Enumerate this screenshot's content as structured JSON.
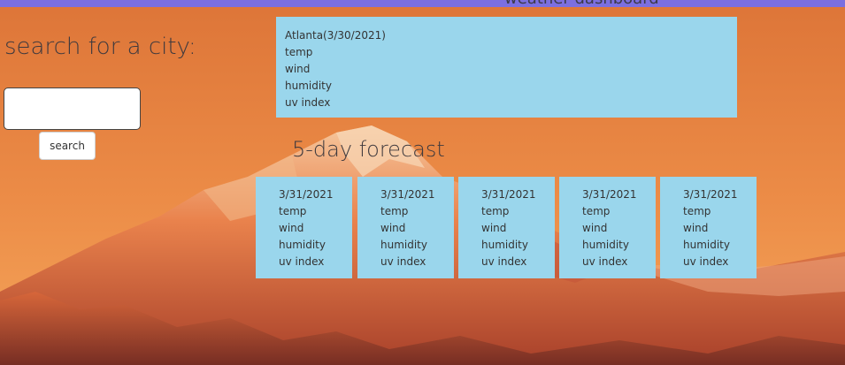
{
  "header": {
    "title": "weather dashboard"
  },
  "search": {
    "label": "search for a city:",
    "input_value": "",
    "button_label": "search"
  },
  "current": {
    "city_date": "Atlanta(3/30/2021)",
    "temp": "temp",
    "wind": "wind",
    "humidity": "humidity",
    "uv": "uv index"
  },
  "forecast": {
    "title": "5-day forecast",
    "days": [
      {
        "date": "3/31/2021",
        "temp": "temp",
        "wind": "wind",
        "humidity": "humidity",
        "uv": "uv index"
      },
      {
        "date": "3/31/2021",
        "temp": "temp",
        "wind": "wind",
        "humidity": "humidity",
        "uv": "uv index"
      },
      {
        "date": "3/31/2021",
        "temp": "temp",
        "wind": "wind",
        "humidity": "humidity",
        "uv": "uv index"
      },
      {
        "date": "3/31/2021",
        "temp": "temp",
        "wind": "wind",
        "humidity": "humidity",
        "uv": "uv index"
      },
      {
        "date": "3/31/2021",
        "temp": "temp",
        "wind": "wind",
        "humidity": "humidity",
        "uv": "uv index"
      }
    ]
  },
  "colors": {
    "header_bar": "#7b6fe0",
    "card_bg": "#9ad6ec",
    "sky_top": "#e0783a",
    "sky_bottom": "#f09a50"
  }
}
